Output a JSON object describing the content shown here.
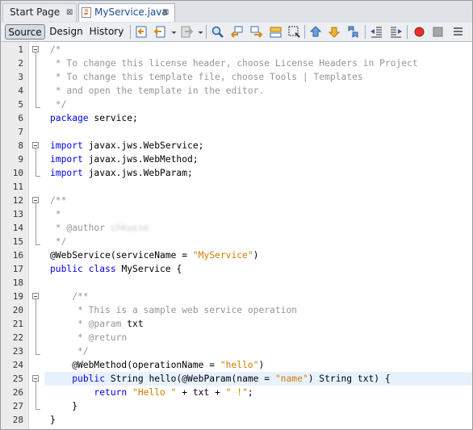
{
  "tabs": [
    {
      "label": "Start Page",
      "close": "⊠"
    },
    {
      "label": "MyService.java",
      "close": "⊠"
    }
  ],
  "toolbar": {
    "views": [
      "Source",
      "Design",
      "History"
    ],
    "selected_view": "Source",
    "icons": [
      "last-edit-icon",
      "back-icon",
      "dropdown-icon",
      "forward-icon",
      "dropdown-icon",
      "find-icon",
      "find-previous-icon",
      "find-next-icon",
      "find-selection-icon",
      "toggle-highlight-icon",
      "previous-bookmark-icon",
      "next-bookmark-icon",
      "toggle-bookmark-icon",
      "shift-left-icon",
      "shift-right-icon",
      "start-macro-icon",
      "stop-macro-icon"
    ]
  },
  "editor": {
    "current_line": 25,
    "line_numbers": [
      "1",
      "2",
      "3",
      "4",
      "5",
      "6",
      "7",
      "8",
      "9",
      "10",
      "11",
      "12",
      "13",
      "14",
      "15",
      "16",
      "17",
      "18",
      "19",
      "20",
      "21",
      "22",
      "23",
      "24",
      "25",
      "26",
      "27",
      "28"
    ],
    "lines": [
      [
        {
          "t": "/*",
          "c": "comment"
        }
      ],
      [
        {
          "t": " * To change this license header, choose License Headers in Project",
          "c": "comment"
        }
      ],
      [
        {
          "t": " * To change this template file, choose Tools | Templates",
          "c": "comment"
        }
      ],
      [
        {
          "t": " * and open the template in the editor.",
          "c": "comment"
        }
      ],
      [
        {
          "t": " */",
          "c": "comment"
        }
      ],
      [
        {
          "t": "package",
          "c": "kw"
        },
        {
          "t": " service;",
          "c": ""
        }
      ],
      [],
      [
        {
          "t": "import",
          "c": "kw"
        },
        {
          "t": " javax.jws.WebService;",
          "c": ""
        }
      ],
      [
        {
          "t": "import",
          "c": "kw"
        },
        {
          "t": " javax.jws.WebMethod;",
          "c": ""
        }
      ],
      [
        {
          "t": "import",
          "c": "kw"
        },
        {
          "t": " javax.jws.WebParam;",
          "c": ""
        }
      ],
      [],
      [
        {
          "t": "/**",
          "c": "comment"
        }
      ],
      [
        {
          "t": " *",
          "c": "comment"
        }
      ],
      [
        {
          "t": " * @author ",
          "c": "comment"
        },
        {
          "t": "chkusse",
          "c": "blur"
        }
      ],
      [
        {
          "t": " */",
          "c": "comment"
        }
      ],
      [
        {
          "t": "@WebService(serviceName = ",
          "c": "ann"
        },
        {
          "t": "\"MyService\"",
          "c": "str"
        },
        {
          "t": ")",
          "c": ""
        }
      ],
      [
        {
          "t": "public",
          "c": "kw"
        },
        {
          "t": " ",
          "c": ""
        },
        {
          "t": "class",
          "c": "kw"
        },
        {
          "t": " MyService {",
          "c": ""
        }
      ],
      [],
      [
        {
          "t": "    /**",
          "c": "comment"
        }
      ],
      [
        {
          "t": "     * This is a sample web service operation",
          "c": "comment"
        }
      ],
      [
        {
          "t": "     * @param ",
          "c": "comment"
        },
        {
          "t": "txt",
          "c": ""
        }
      ],
      [
        {
          "t": "     * @return",
          "c": "comment"
        }
      ],
      [
        {
          "t": "     */",
          "c": "comment"
        }
      ],
      [
        {
          "t": "    @WebMethod(operationName = ",
          "c": "ann"
        },
        {
          "t": "\"hello\"",
          "c": "str"
        },
        {
          "t": ")",
          "c": ""
        }
      ],
      [
        {
          "t": "    ",
          "c": ""
        },
        {
          "t": "public",
          "c": "kw"
        },
        {
          "t": " String hello(@WebParam(name = ",
          "c": ""
        },
        {
          "t": "\"name\"",
          "c": "str"
        },
        {
          "t": ") String txt) {",
          "c": ""
        }
      ],
      [
        {
          "t": "        ",
          "c": ""
        },
        {
          "t": "return",
          "c": "kw"
        },
        {
          "t": " ",
          "c": ""
        },
        {
          "t": "\"Hello \"",
          "c": "str"
        },
        {
          "t": " + txt + ",
          "c": ""
        },
        {
          "t": "\" !\"",
          "c": "str"
        },
        {
          "t": ";",
          "c": ""
        }
      ],
      [
        {
          "t": "    }",
          "c": ""
        }
      ],
      [
        {
          "t": "}",
          "c": ""
        }
      ]
    ]
  }
}
